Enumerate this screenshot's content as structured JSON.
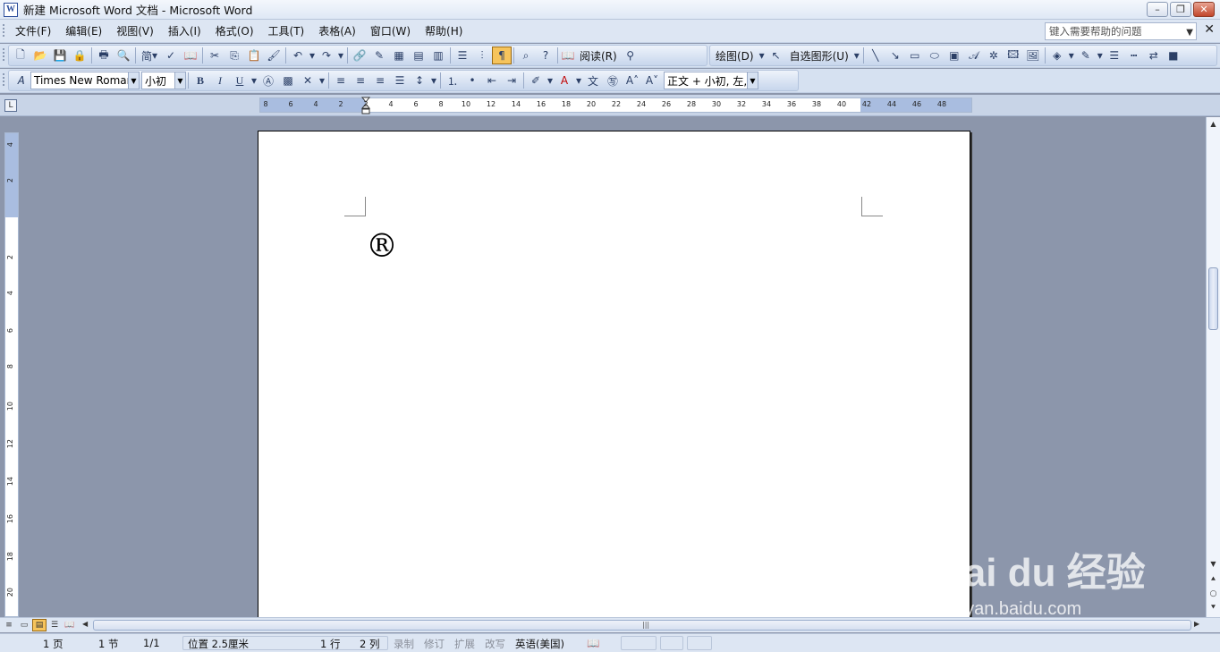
{
  "window": {
    "title": "新建 Microsoft Word 文档 - Microsoft Word",
    "min": "–",
    "max": "❐",
    "close": "✕"
  },
  "menubar": {
    "items": [
      "文件(F)",
      "编辑(E)",
      "视图(V)",
      "插入(I)",
      "格式(O)",
      "工具(T)",
      "表格(A)",
      "窗口(W)",
      "帮助(H)"
    ],
    "help_placeholder": "键入需要帮助的问题",
    "doc_close": "✕"
  },
  "toolbar1": {
    "simplified_label": "简",
    "read_label": "阅读(R)",
    "draw_label": "绘图(D)",
    "autoshape_label": "自选图形(U)"
  },
  "toolbar2": {
    "font_name": "Times New Roman",
    "font_size": "小初",
    "bold": "B",
    "italic": "I",
    "underline": "U",
    "style_value": "正文 + 小初, 左,"
  },
  "ruler": {
    "h_ticks": [
      "8",
      "6",
      "4",
      "2",
      "2",
      "4",
      "6",
      "8",
      "10",
      "12",
      "14",
      "16",
      "18",
      "20",
      "22",
      "24",
      "26",
      "28",
      "30",
      "32",
      "34",
      "36",
      "38",
      "40",
      "42",
      "44",
      "46",
      "48"
    ],
    "v_ticks": [
      "4",
      "2",
      "2",
      "4",
      "6",
      "8",
      "10",
      "12",
      "14",
      "16",
      "18",
      "20"
    ]
  },
  "document": {
    "content": "®"
  },
  "statusbar": {
    "page": "1 页",
    "section": "1 节",
    "page_count": "1/1",
    "position": "位置 2.5厘米",
    "line": "1 行",
    "column": "2 列",
    "rec": "录制",
    "trk": "修订",
    "ext": "扩展",
    "ovr": "改写",
    "language": "英语(美国)"
  },
  "watermark": {
    "brand": "Bai du 经验",
    "url": "jingyan.baidu.com"
  }
}
